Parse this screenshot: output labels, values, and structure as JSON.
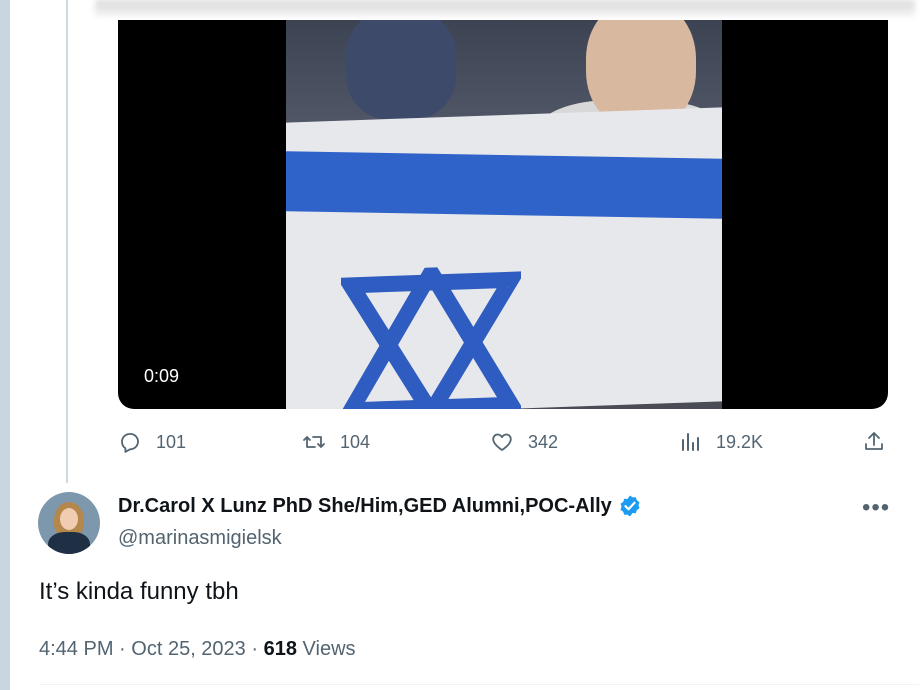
{
  "video": {
    "duration": "0:09"
  },
  "actions": {
    "replies": "101",
    "retweets": "104",
    "likes": "342",
    "views": "19.2K",
    "icons": [
      "reply-icon",
      "retweet-icon",
      "like-icon",
      "views-icon",
      "share-icon"
    ]
  },
  "tweet": {
    "display_name": "Dr.Carol X Lunz PhD She/Him,GED Alumni,POC-Ally",
    "handle": "@marinasmigielsk",
    "text": "It’s kinda funny tbh",
    "time": "4:44 PM",
    "date": "Oct 25, 2023",
    "separator": "·",
    "views_count": "618",
    "views_label": "Views",
    "more": "•••"
  },
  "colors": {
    "accent": "#1d9bf0",
    "muted": "#536471",
    "text": "#0f1419"
  }
}
